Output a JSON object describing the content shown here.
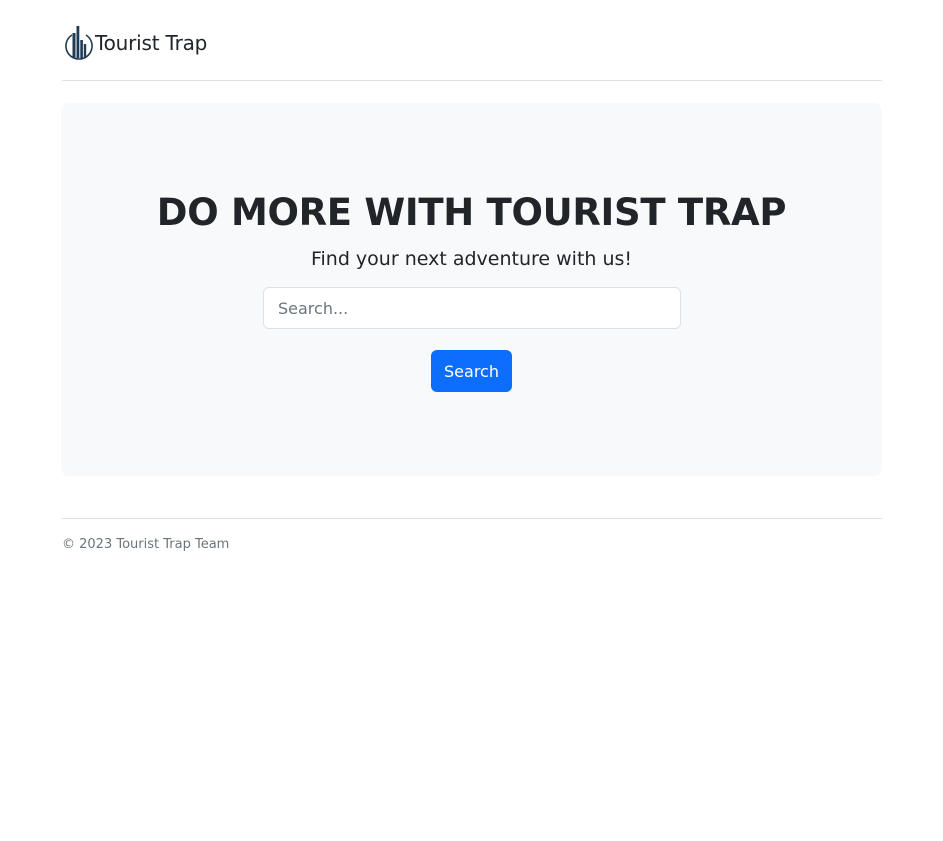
{
  "header": {
    "brand_name": "Tourist Trap",
    "logo_icon": "city-skyline-icon"
  },
  "hero": {
    "title": "DO MORE WITH TOURIST TRAP",
    "subtitle": "Find your next adventure with us!",
    "search": {
      "placeholder": "Search...",
      "value": ""
    },
    "search_button_label": "Search"
  },
  "footer": {
    "copyright": "© 2023 Tourist Trap Team"
  },
  "colors": {
    "primary": "#0d6efd",
    "hero_background": "#f8f9fa",
    "text": "#212529",
    "muted_text": "#6c757d",
    "border": "#dee2e6",
    "logo_dark": "#1f3b57"
  }
}
